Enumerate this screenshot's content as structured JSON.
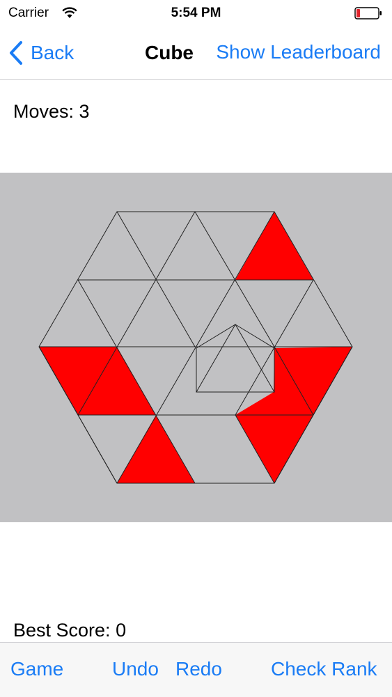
{
  "status_bar": {
    "carrier": "Carrier",
    "time": "5:54 PM",
    "battery_color": "#e0242c"
  },
  "nav": {
    "back_label": "Back",
    "title": "Cube",
    "leaderboard_label": "Show Leaderboard",
    "accent": "#1a7cf5"
  },
  "game": {
    "moves_label": "Moves: ",
    "moves": "3",
    "best_score_label": "Best Score: ",
    "best_score": "0",
    "board_color": "#c1c1c3",
    "tile_color": "#ff0000"
  },
  "toolbar": {
    "game_label": "Game",
    "undo_label": "Undo",
    "redo_label": "Redo",
    "check_rank_label": "Check Rank"
  }
}
